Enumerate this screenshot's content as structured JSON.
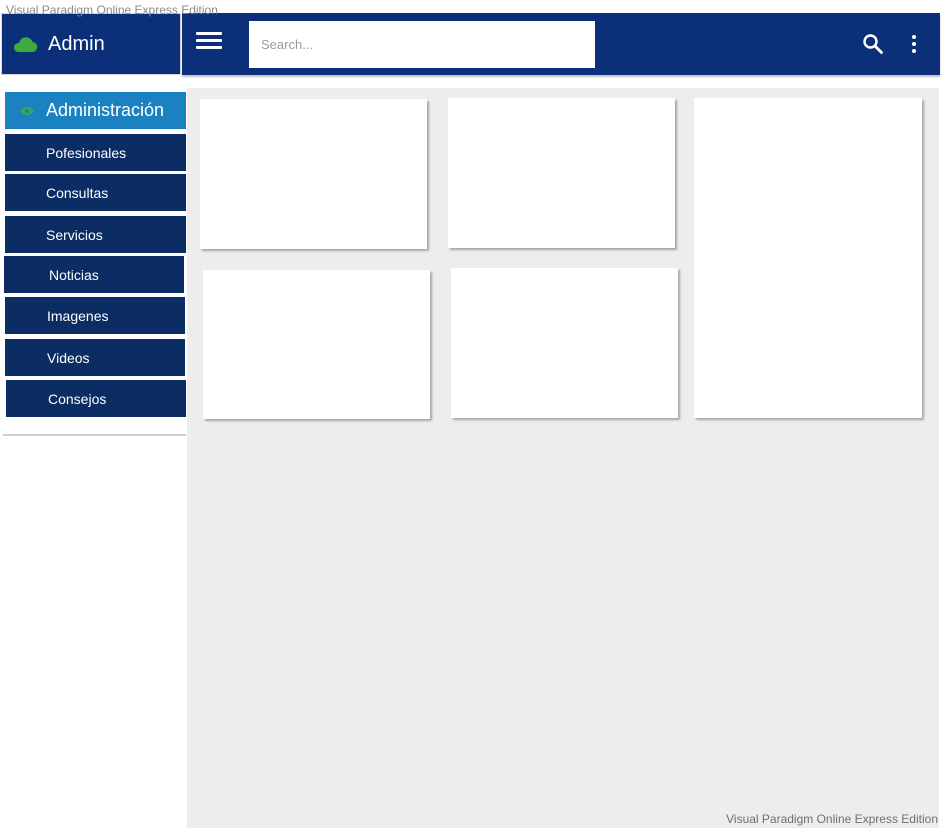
{
  "watermark": "Visual Paradigm Online Express Edition",
  "brand": {
    "title": "Admin",
    "icon": "cloud-icon",
    "icon_color": "#3dab3d"
  },
  "topbar": {
    "search_placeholder": "Search...",
    "menu_icon": "hamburger-menu-icon",
    "search_icon": "search-icon",
    "more_icon": "more-vert-icon",
    "background": "#0b3079"
  },
  "sidebar": {
    "header": {
      "label": "Administración",
      "icon": "eye-icon",
      "background": "#1a82c0"
    },
    "items": [
      {
        "label": "Pofesionales"
      },
      {
        "label": "Consultas"
      },
      {
        "label": "Servicios"
      },
      {
        "label": "Noticias"
      },
      {
        "label": "Imagenes"
      },
      {
        "label": "Videos"
      },
      {
        "label": "Consejos"
      }
    ],
    "item_background": "#0b2d63"
  },
  "main": {
    "background": "#ededed",
    "card_count": 5
  }
}
